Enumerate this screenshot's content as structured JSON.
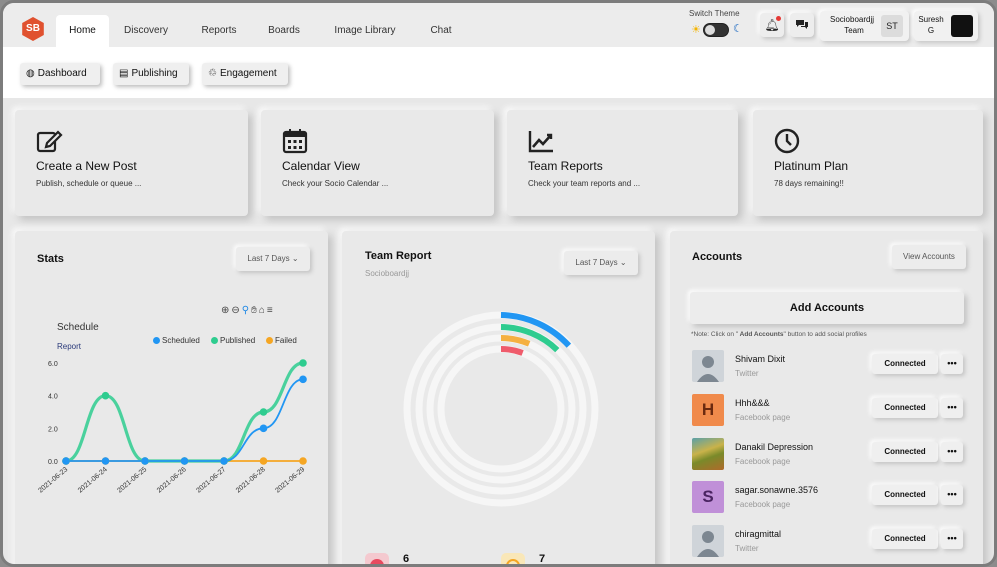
{
  "nav": {
    "logo": "SB",
    "tabs": [
      "Home",
      "Discovery",
      "Reports",
      "Boards",
      "Image Library",
      "Chat"
    ]
  },
  "theme": {
    "label": "Switch Theme"
  },
  "team_user": {
    "name_line1": "Socioboardjj",
    "name_line2": "Team",
    "initials": "ST"
  },
  "current_user": {
    "name_line1": "Suresh",
    "name_line2": "G"
  },
  "subnav": [
    {
      "icon": "dashboard-icon",
      "label": "Dashboard"
    },
    {
      "icon": "publishing-icon",
      "label": "Publishing"
    },
    {
      "icon": "engagement-icon",
      "label": "Engagement"
    }
  ],
  "quick_cards": [
    {
      "icon": "edit-icon",
      "title": "Create a New Post",
      "desc": "Publish, schedule or queue ..."
    },
    {
      "icon": "calendar-icon",
      "title": "Calendar View",
      "desc": "Check your Socio Calendar ..."
    },
    {
      "icon": "chart-line-icon",
      "title": "Team Reports",
      "desc": "Check your team reports and ..."
    },
    {
      "icon": "clock-icon",
      "title": "Platinum Plan",
      "desc": "78 days remaining!!"
    }
  ],
  "stats": {
    "title": "Stats",
    "range": "Last 7 Days",
    "chart_title": "Schedule",
    "chart_subtitle": "Report"
  },
  "chart_data": {
    "type": "line",
    "title": "Schedule",
    "subtitle": "Report",
    "categories": [
      "2021-06-23",
      "2021-06-24",
      "2021-06-25",
      "2021-06-26",
      "2021-06-27",
      "2021-06-28",
      "2021-06-29"
    ],
    "ylim": [
      0,
      6
    ],
    "yticks": [
      "0.0",
      "2.0",
      "4.0",
      "6.0"
    ],
    "series": [
      {
        "name": "Scheduled",
        "color": "#2196f3",
        "values": [
          0,
          0,
          0,
          0,
          0,
          2,
          5
        ]
      },
      {
        "name": "Published",
        "color": "#2ecc8f",
        "values": [
          0,
          4,
          0,
          0,
          0,
          3,
          6
        ]
      },
      {
        "name": "Failed",
        "color": "#f5a623",
        "values": [
          0,
          0,
          0,
          0,
          0,
          0,
          0
        ]
      }
    ],
    "legend": "top-right"
  },
  "team_report": {
    "title": "Team Report",
    "subtitle": "Socioboardjj",
    "range": "Last 7 Days",
    "stat1": "6",
    "stat2": "7",
    "ring_colors": [
      "#2196f3",
      "#2ecc8f",
      "#f5b041",
      "#ef5b6b"
    ]
  },
  "accounts": {
    "title": "Accounts",
    "view_btn": "View Accounts",
    "add_btn": "Add Accounts",
    "note_prefix": "*Note: Click on \"",
    "note_bold": " Add Accounts",
    "note_suffix": "\" button to add social profiles",
    "connected_label": "Connected",
    "more_label": "•••",
    "list": [
      {
        "name": "Shivam Dixit",
        "type": "Twitter",
        "avatar": "person"
      },
      {
        "name": "Hhh&&&",
        "type": "Facebook page",
        "avatar": "H",
        "color": "#f08a4b"
      },
      {
        "name": "Danakil Depression",
        "type": "Facebook page",
        "avatar": "landscape"
      },
      {
        "name": "sagar.sonawne.3576",
        "type": "Facebook page",
        "avatar": "S",
        "color": "#c090d8"
      },
      {
        "name": "chiragmittal",
        "type": "Twitter",
        "avatar": "person"
      }
    ]
  }
}
